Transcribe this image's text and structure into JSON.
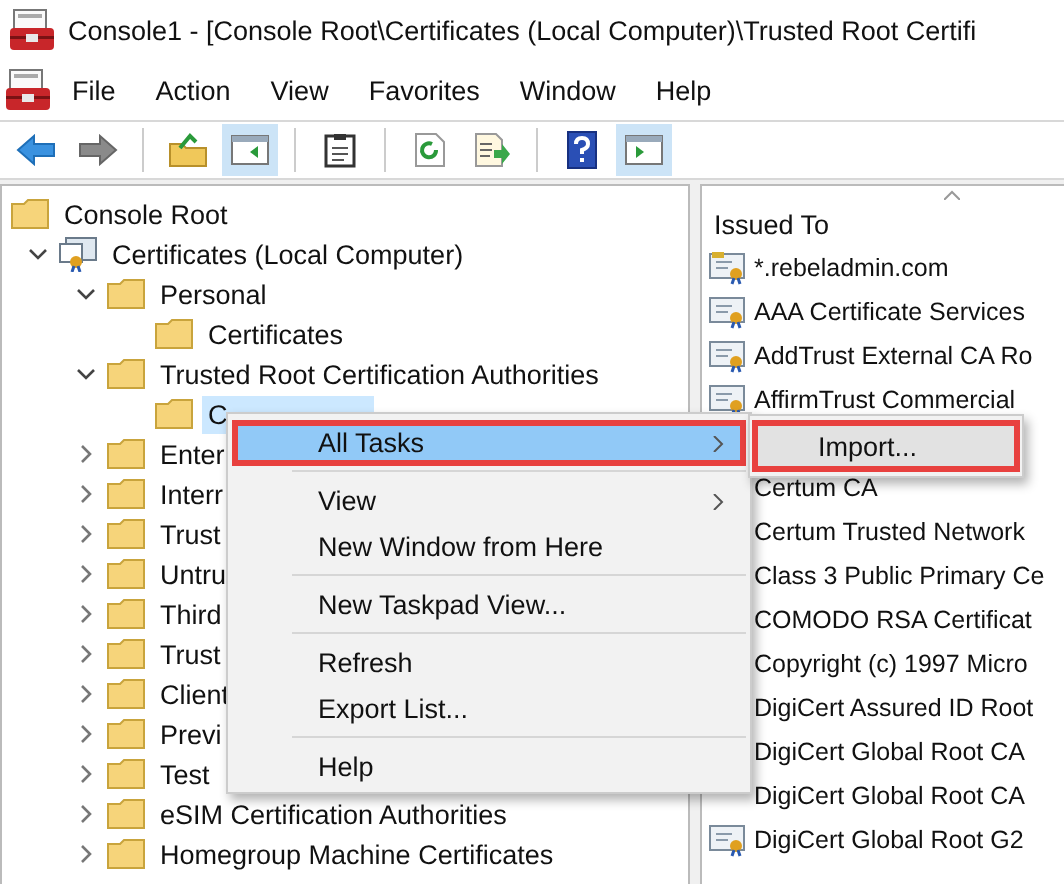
{
  "window": {
    "title": "Console1 - [Console Root\\Certificates (Local Computer)\\Trusted Root Certifi"
  },
  "menu_bar": [
    "File",
    "Action",
    "View",
    "Favorites",
    "Window",
    "Help"
  ],
  "toolbar": [
    {
      "kind": "back",
      "pressed": false
    },
    {
      "kind": "forward",
      "pressed": false
    },
    {
      "kind": "separator"
    },
    {
      "kind": "up",
      "pressed": false
    },
    {
      "kind": "tree-pane",
      "pressed": true
    },
    {
      "kind": "separator"
    },
    {
      "kind": "properties",
      "pressed": false
    },
    {
      "kind": "separator"
    },
    {
      "kind": "refresh",
      "pressed": false
    },
    {
      "kind": "export",
      "pressed": false
    },
    {
      "kind": "separator"
    },
    {
      "kind": "help",
      "pressed": false
    },
    {
      "kind": "action-pane",
      "pressed": true
    }
  ],
  "tree": [
    {
      "label": "Console Root",
      "kind": "folder",
      "selected": false,
      "children": [
        {
          "label": "Certificates (Local Computer)",
          "kind": "store",
          "expanded": true,
          "selected": false,
          "children": [
            {
              "label": "Personal",
              "kind": "folder",
              "expanded": true,
              "selected": false,
              "children": [
                {
                  "label": "Certificates",
                  "kind": "folder",
                  "selected": false
                }
              ]
            },
            {
              "label": "Trusted Root Certification Authorities",
              "kind": "folder",
              "expanded": true,
              "selected": false,
              "children": [
                {
                  "label": "C",
                  "kind": "folder",
                  "selected": true
                }
              ]
            },
            {
              "label": "Enter",
              "kind": "folder",
              "expanded": false,
              "selected": false
            },
            {
              "label": "Interr",
              "kind": "folder",
              "expanded": false,
              "selected": false
            },
            {
              "label": "Trust",
              "kind": "folder",
              "expanded": false,
              "selected": false
            },
            {
              "label": "Untru",
              "kind": "folder",
              "expanded": false,
              "selected": false
            },
            {
              "label": "Third",
              "kind": "folder",
              "expanded": false,
              "selected": false
            },
            {
              "label": "Trust",
              "kind": "folder",
              "expanded": false,
              "selected": false
            },
            {
              "label": "Client",
              "kind": "folder",
              "expanded": false,
              "selected": false
            },
            {
              "label": "Previ",
              "kind": "folder",
              "expanded": false,
              "selected": false
            },
            {
              "label": "Test",
              "kind": "folder",
              "expanded": false,
              "selected": false
            },
            {
              "label": "eSIM Certification Authorities",
              "kind": "folder",
              "expanded": false,
              "selected": false
            },
            {
              "label": "Homegroup Machine Certificates",
              "kind": "folder",
              "expanded": false,
              "selected": false
            }
          ]
        }
      ]
    }
  ],
  "list": {
    "column": "Issued To",
    "items": [
      {
        "label": "*.rebeladmin.com",
        "kind": "key-certificate"
      },
      {
        "label": "AAA Certificate Services",
        "kind": "certificate"
      },
      {
        "label": "AddTrust External CA Ro",
        "kind": "certificate"
      },
      {
        "label": "AffirmTrust Commercial",
        "kind": "certificate"
      },
      {
        "label": "Certum CA",
        "kind": "covered"
      },
      {
        "label": "Certum Trusted Network",
        "kind": "covered"
      },
      {
        "label": "Class 3 Public Primary Ce",
        "kind": "covered"
      },
      {
        "label": "COMODO RSA Certificat",
        "kind": "covered"
      },
      {
        "label": "Copyright (c) 1997 Micro",
        "kind": "covered"
      },
      {
        "label": "DigiCert Assured ID Root",
        "kind": "covered"
      },
      {
        "label": "DigiCert Global Root CA",
        "kind": "covered"
      },
      {
        "label": "DigiCert Global Root CA",
        "kind": "covered"
      },
      {
        "label": "DigiCert Global Root G2",
        "kind": "certificate"
      }
    ]
  },
  "context_menu": {
    "items": [
      {
        "kind": "item",
        "label": "All Tasks",
        "submenu": true,
        "highlighted": true
      },
      {
        "kind": "separator"
      },
      {
        "kind": "item",
        "label": "View",
        "submenu": true,
        "highlighted": false
      },
      {
        "kind": "item",
        "label": "New Window from Here",
        "submenu": false,
        "highlighted": false
      },
      {
        "kind": "separator"
      },
      {
        "kind": "item",
        "label": "New Taskpad View...",
        "submenu": false,
        "highlighted": false
      },
      {
        "kind": "separator"
      },
      {
        "kind": "item",
        "label": "Refresh",
        "submenu": false,
        "highlighted": false
      },
      {
        "kind": "item",
        "label": "Export List...",
        "submenu": false,
        "highlighted": false
      },
      {
        "kind": "separator"
      },
      {
        "kind": "item",
        "label": "Help",
        "submenu": false,
        "highlighted": false
      }
    ],
    "submenu": [
      {
        "label": "Import...",
        "highlighted": true
      }
    ]
  }
}
